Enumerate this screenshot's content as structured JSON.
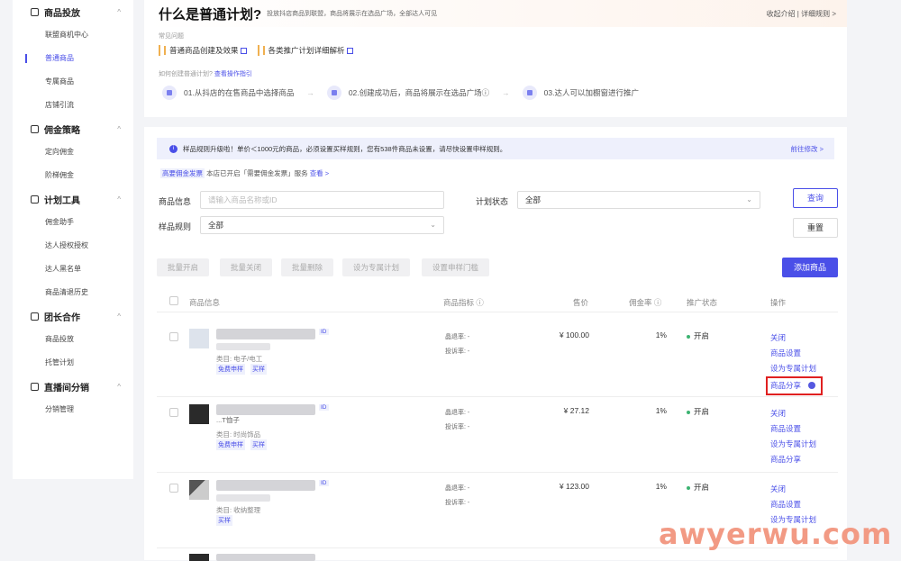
{
  "sidebar": {
    "groups": [
      {
        "title": "商品投放",
        "items": [
          "联盟商机中心",
          "普通商品",
          "专属商品",
          "店铺引流"
        ]
      },
      {
        "title": "佣金策略",
        "items": [
          "定向佣金",
          "阶梯佣金"
        ]
      },
      {
        "title": "计划工具",
        "items": [
          "佣金助手",
          "达人授权授权",
          "达人黑名单",
          "商品清退历史"
        ]
      },
      {
        "title": "团长合作",
        "items": [
          "商品投放",
          "托管计划"
        ]
      },
      {
        "title": "直播间分销",
        "items": [
          "分销管理"
        ]
      }
    ],
    "active_item": "普通商品"
  },
  "header": {
    "title": "什么是普通计划?",
    "subtitle": "投放抖店商品到联盟，商品将展示在选品广场，全部达人可见",
    "links": "收起介绍  |  详细规则  >"
  },
  "faq": {
    "heading": "常见问题",
    "items": [
      "普通商品创建及效果",
      "各类推广计划详细解析"
    ]
  },
  "how": {
    "text": "如何创建普通计划?",
    "link": "查看操作指引"
  },
  "steps": [
    "01.从抖店的在售商品中选择商品",
    "02.创建成功后，商品将展示在选品广场",
    "03.达人可以加橱窗进行推广"
  ],
  "notice": {
    "text": "样品规则升级啦！单价＜1000元的商品，必须设置买样规则，您有538件商品未设置，请尽快设置申样规则。",
    "link": "前往修改 >"
  },
  "tagline": {
    "tag": "高要佣金发票",
    "text": "本店已开启「需要佣金发票」服务",
    "link": "查看 >"
  },
  "filters": {
    "product_label": "商品信息",
    "product_placeholder": "请输入商品名称或ID",
    "plan_status_label": "计划状态",
    "plan_status_value": "全部",
    "sample_label": "样品规则",
    "sample_value": "全部",
    "query": "查询",
    "reset": "重置"
  },
  "bulk_actions": [
    "批量开启",
    "批量关闭",
    "批量删除",
    "设为专属计划",
    "设置申样门槛"
  ],
  "add_button": "添加商品",
  "table": {
    "headers": [
      "商品信息",
      "商品指标 ⓘ",
      "售价",
      "佣金率 ⓘ",
      "推广状态",
      "操作"
    ],
    "rows": [
      {
        "id_tag": "ID",
        "name": "",
        "category": "类目: 电子/电工",
        "chips": [
          "免费申样",
          "买样"
        ],
        "metrics": [
          "晶退率:  -",
          "投诉率:  -"
        ],
        "price": "¥ 100.00",
        "rate": "1%",
        "status": "开启",
        "ops": [
          "关闭",
          "商品设置",
          "设为专属计划",
          "商品分享"
        ]
      },
      {
        "id_tag": "ID",
        "name": "...T恤子",
        "category": "类目: 时尚饰品",
        "chips": [
          "免费申样",
          "买样"
        ],
        "metrics": [
          "晶退率:  -",
          "投诉率:  -"
        ],
        "price": "¥ 27.12",
        "rate": "1%",
        "status": "开启",
        "ops": [
          "关闭",
          "商品设置",
          "设为专属计划",
          "商品分享"
        ]
      },
      {
        "id_tag": "ID",
        "name": "",
        "category": "类目: 收纳整理",
        "chips": [
          "买样"
        ],
        "metrics": [
          "晶退率:  -",
          "投诉率:  -"
        ],
        "price": "¥ 123.00",
        "rate": "1%",
        "status": "开启",
        "ops": [
          "关闭",
          "商品设置",
          "设为专属计划"
        ]
      }
    ]
  },
  "watermark": "awyerwu.com",
  "colors": {
    "accent": "#4a4fe8",
    "highlight": "#e02020",
    "status_on": "#3cb371"
  }
}
